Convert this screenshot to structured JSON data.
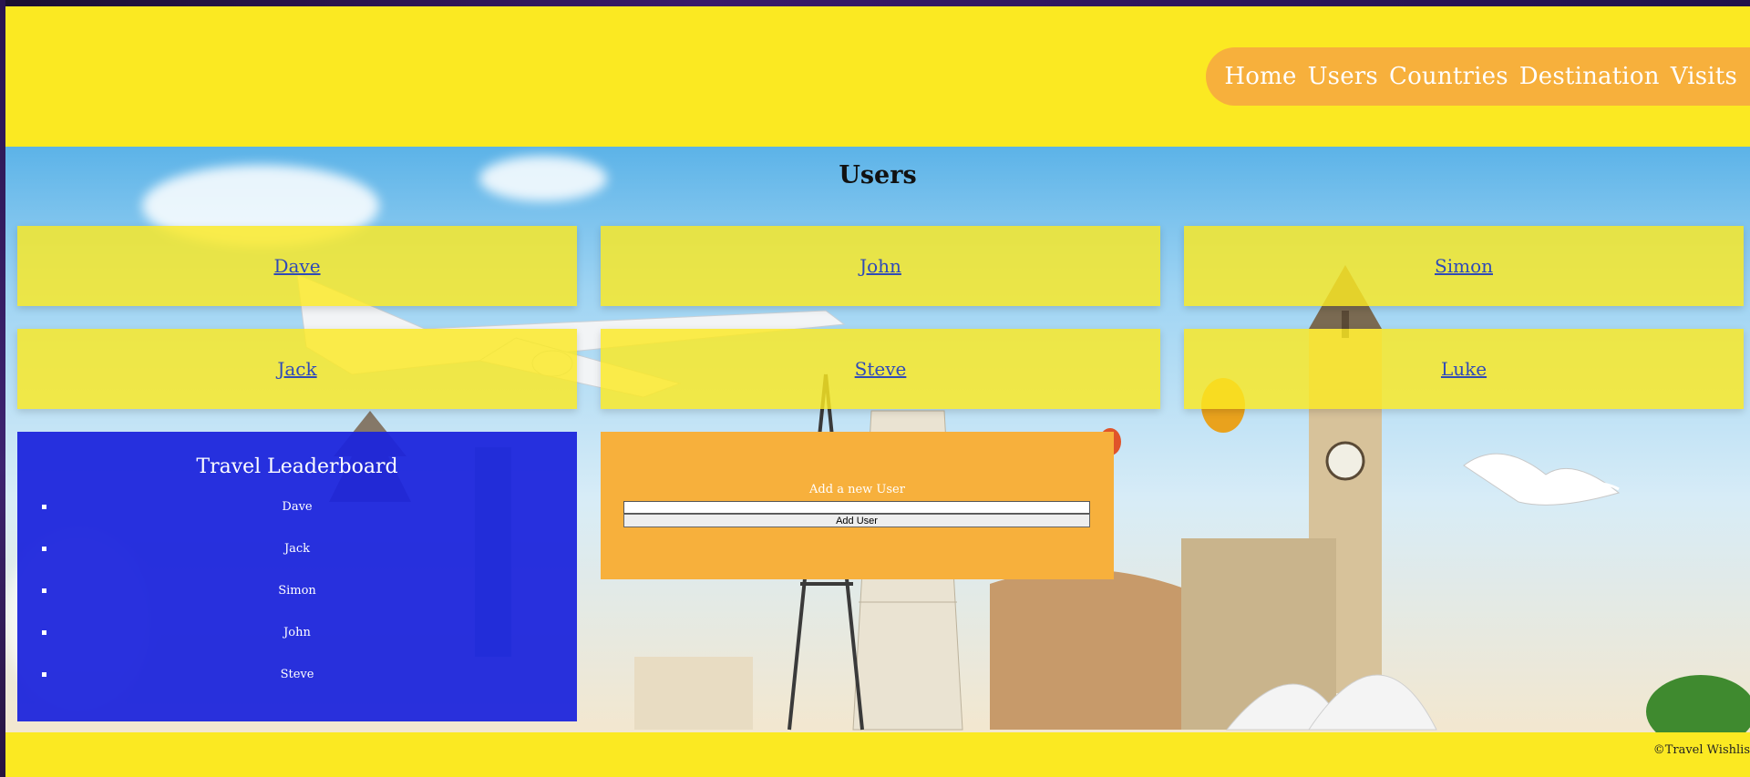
{
  "nav": {
    "items": [
      "Home",
      "Users",
      "Countries",
      "Destination",
      "Visits"
    ]
  },
  "main": {
    "title": "Users",
    "users": [
      "Dave",
      "John",
      "Simon",
      "Jack",
      "Steve",
      "Luke"
    ]
  },
  "leaderboard": {
    "title": "Travel Leaderboard",
    "entries": [
      "Dave",
      "Jack",
      "Simon",
      "John",
      "Steve"
    ]
  },
  "add_user": {
    "label": "Add a new User",
    "input_value": "",
    "button_label": "Add User"
  },
  "footer": {
    "copyright": "©Travel Wishlis"
  },
  "colors": {
    "header_bg": "#fbe922",
    "nav_bg": "#f7b03c",
    "leaderboard_bg": "#1c24dc",
    "link": "#2f4ab8"
  }
}
